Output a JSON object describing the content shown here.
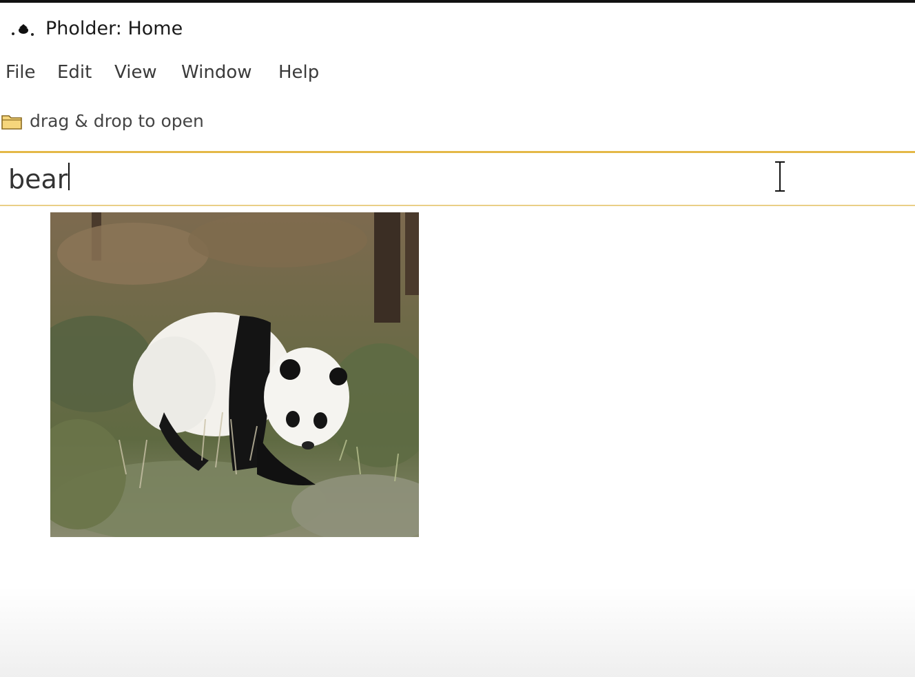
{
  "window": {
    "title": "Pholder: Home"
  },
  "menu": {
    "items": [
      {
        "label": "File"
      },
      {
        "label": "Edit"
      },
      {
        "label": "View"
      },
      {
        "label": "Window"
      },
      {
        "label": "Help"
      }
    ]
  },
  "open_bar": {
    "label": "drag & drop to open",
    "icon": "folder-icon"
  },
  "search": {
    "value": "bear",
    "accent_color": "#e4b847"
  },
  "results": {
    "items": [
      {
        "subject": "panda",
        "icon": "photo-thumbnail"
      }
    ]
  }
}
